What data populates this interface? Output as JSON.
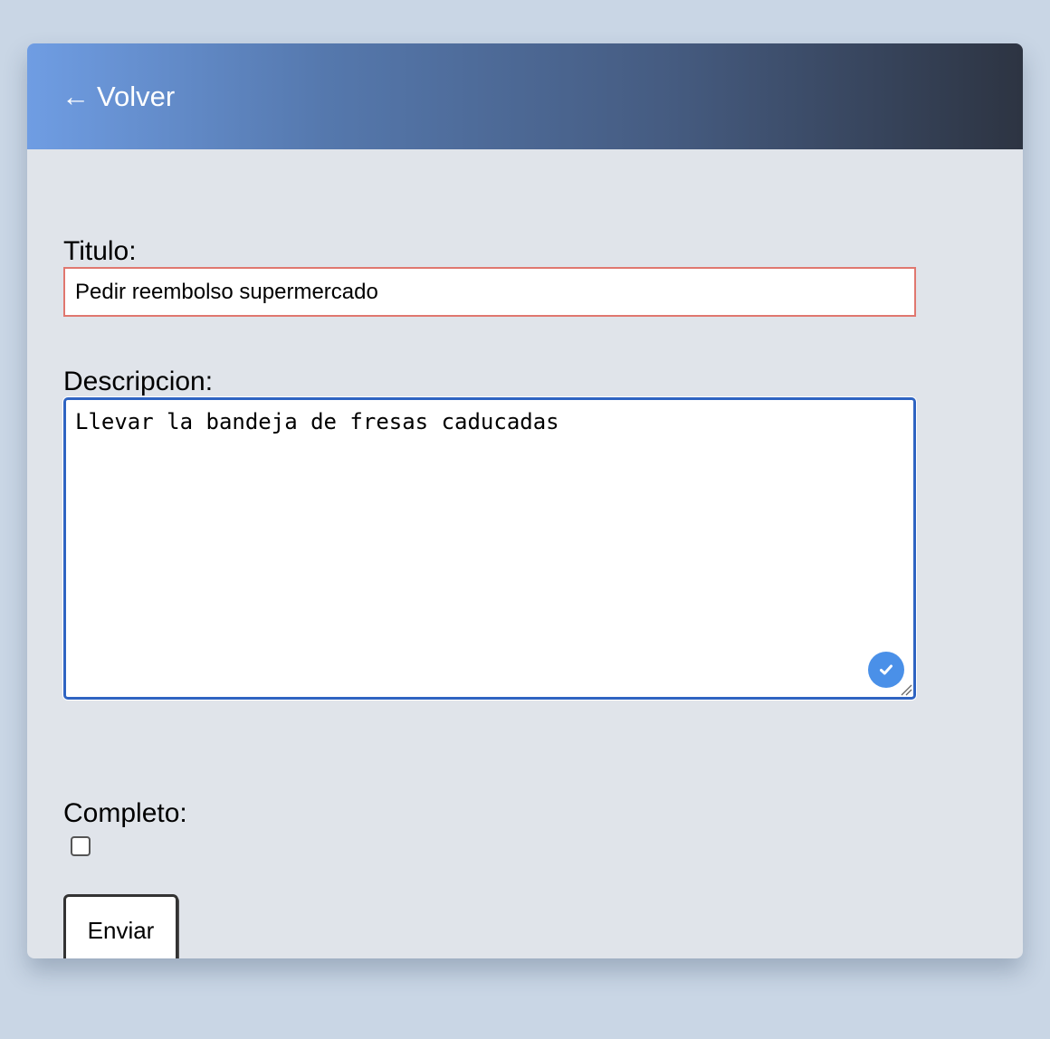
{
  "header": {
    "back_arrow": "←",
    "back_label": "Volver"
  },
  "form": {
    "title_label": "Titulo:",
    "title_value": "Pedir reembolso supermercado",
    "description_label": "Descripcion:",
    "description_value": "Llevar la bandeja de fresas caducadas",
    "completed_label": "Completo:",
    "completed_checked": false,
    "submit_label": "Enviar"
  },
  "colors": {
    "page_background": "#c9d6e5",
    "card_background": "#e0e4ea",
    "header_gradient_start": "#6f9de3",
    "header_gradient_end": "#2d3442",
    "title_border": "#e0776f",
    "description_focus_border": "#2f64c2",
    "check_badge": "#4a90e8"
  },
  "icons": {
    "back": "left-arrow-icon",
    "description_status": "checkmark-circle-icon",
    "resize": "resize-handle-icon"
  }
}
